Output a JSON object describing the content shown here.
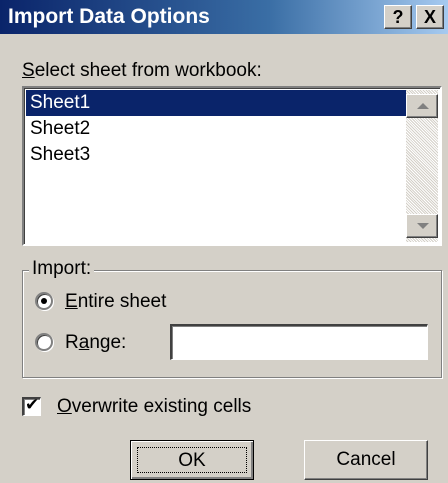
{
  "window": {
    "title": "Import Data Options",
    "help_label": "?",
    "close_label": "X"
  },
  "sheet_select": {
    "label_prefix": "S",
    "label_rest": "elect sheet from workbook:",
    "items": [
      {
        "label": "Sheet1",
        "selected": true
      },
      {
        "label": "Sheet2",
        "selected": false
      },
      {
        "label": "Sheet3",
        "selected": false
      }
    ]
  },
  "import_group": {
    "legend": "Import:",
    "entire_sheet": {
      "accel": "E",
      "rest": "ntire sheet",
      "checked": true
    },
    "range": {
      "before": "R",
      "accel": "a",
      "rest": "nge:",
      "checked": false,
      "value": ""
    }
  },
  "overwrite": {
    "accel": "O",
    "rest": "verwrite existing cells",
    "checked": true,
    "check_glyph": "✔"
  },
  "buttons": {
    "ok": "OK",
    "cancel": "Cancel"
  },
  "colors": {
    "title_bar": "#0a246a",
    "face": "#d4d0c8",
    "selection": "#0a246a"
  }
}
